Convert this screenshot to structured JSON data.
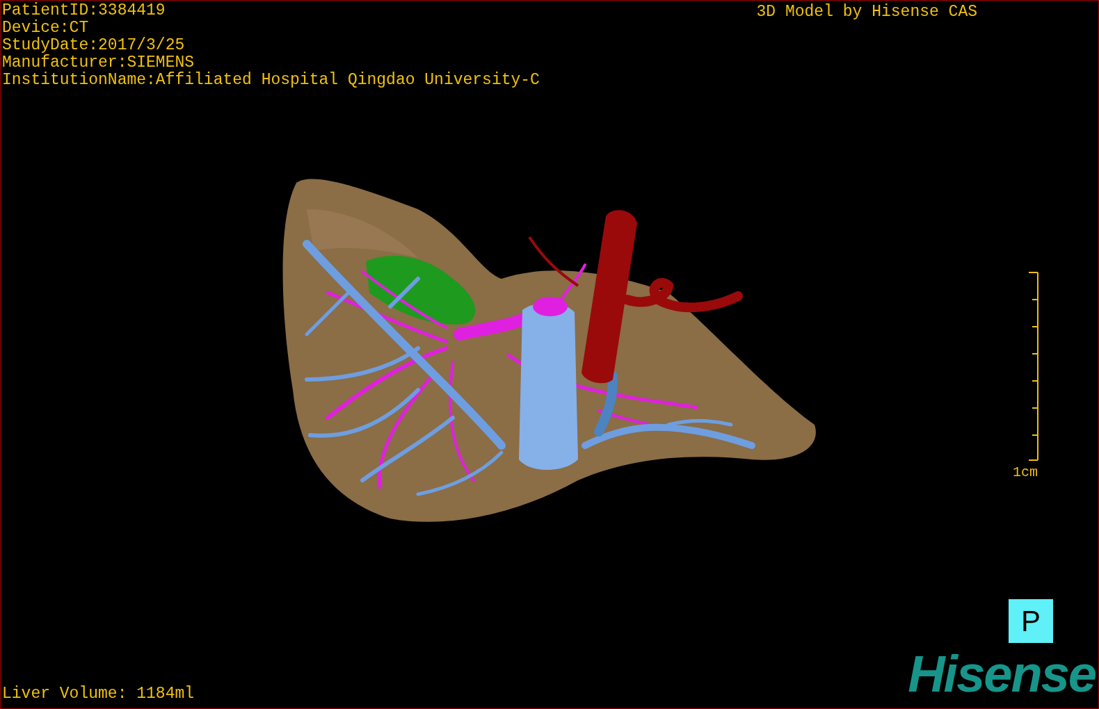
{
  "study_info": [
    {
      "text": "PatientID:3384419"
    },
    {
      "text": "Device:CT"
    },
    {
      "text": "StudyDate:2017/3/25"
    },
    {
      "text": "Manufacturer:SIEMENS"
    },
    {
      "text": "InstitutionName:Affiliated Hospital Qingdao University-C"
    }
  ],
  "model_title": "3D Model by Hisense CAS",
  "scale_bar": {
    "label": "1cm"
  },
  "orientation_marker": "P",
  "logo": "Hisense",
  "liver_volume": "Liver Volume: 1184ml"
}
